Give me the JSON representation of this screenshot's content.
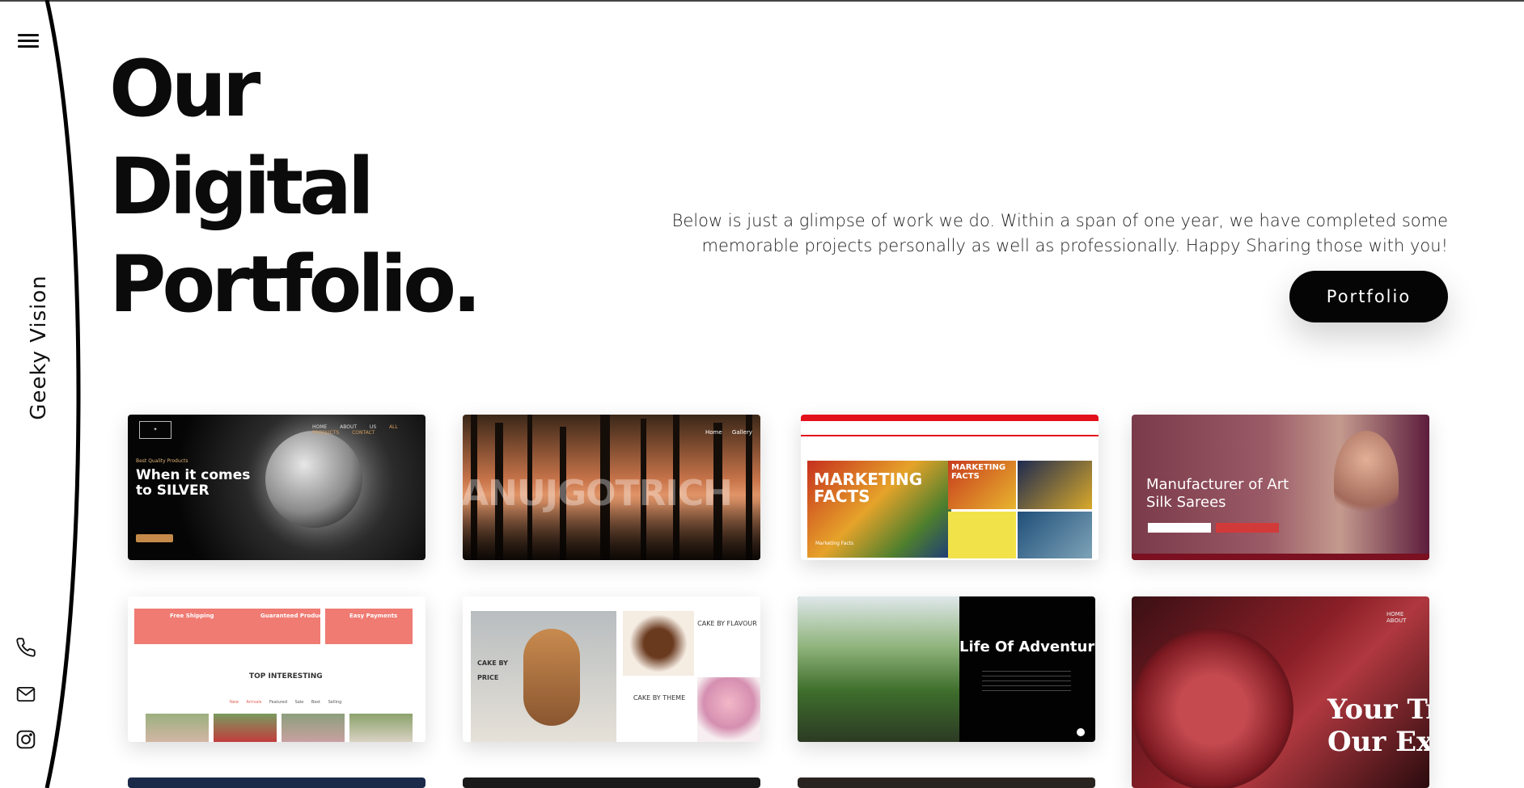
{
  "sidebar": {
    "brand": "Geeky Vision",
    "menu_icon": "hamburger-menu-icon",
    "contact_icons": [
      "phone-icon",
      "mail-icon",
      "instagram-icon"
    ]
  },
  "hero": {
    "title_lines": [
      "Our",
      "Digital",
      "Portfolio."
    ],
    "description": "Below is just a glimpse of work we do. Within a span of one year, we have completed some memorable projects personally as well as professionally. Happy Sharing those with you!",
    "button_label": "Portfolio"
  },
  "projects": [
    {
      "name": "silver",
      "headline": "When it comes to SILVER",
      "eyebrow": "Best Quality Products",
      "nav": [
        "HOME",
        "ABOUT US",
        "ALL PRODUCTS",
        "CONTACT"
      ]
    },
    {
      "name": "anujgotrich",
      "watermark": "ANUJGOTRICH",
      "nav": [
        "Home",
        "Gallery"
      ]
    },
    {
      "name": "marketing-facts",
      "headline": "MARKETING FACTS",
      "sub_headline": "MARKETING FACTS",
      "caption": "Marketing Facts"
    },
    {
      "name": "art-silk-sarees",
      "headline": "Manufacturer of Art Silk Sarees"
    },
    {
      "name": "shop",
      "features": [
        "Free Shipping",
        "Guaranteed Product",
        "Easy Payments"
      ],
      "section_title": "TOP INTERESTING",
      "filters": [
        "New Arrivals",
        "Featured",
        "Sale",
        "Best Selling"
      ]
    },
    {
      "name": "cake-store",
      "labels": [
        "CAKE BY PRICE",
        "CAKE BY FLAVOUR",
        "CAKE BY THEME"
      ]
    },
    {
      "name": "adventure",
      "headline": "Life Of Adventure"
    },
    {
      "name": "investment",
      "headline_1": "Your Tr",
      "headline_2": "Our Exp",
      "nav": [
        "HOME",
        "ABOUT"
      ]
    }
  ],
  "colors": {
    "accent": "#050505",
    "marketing_red": "#e3111b",
    "shop_salmon": "#ef7b73",
    "saree_red": "#d23a3a"
  }
}
